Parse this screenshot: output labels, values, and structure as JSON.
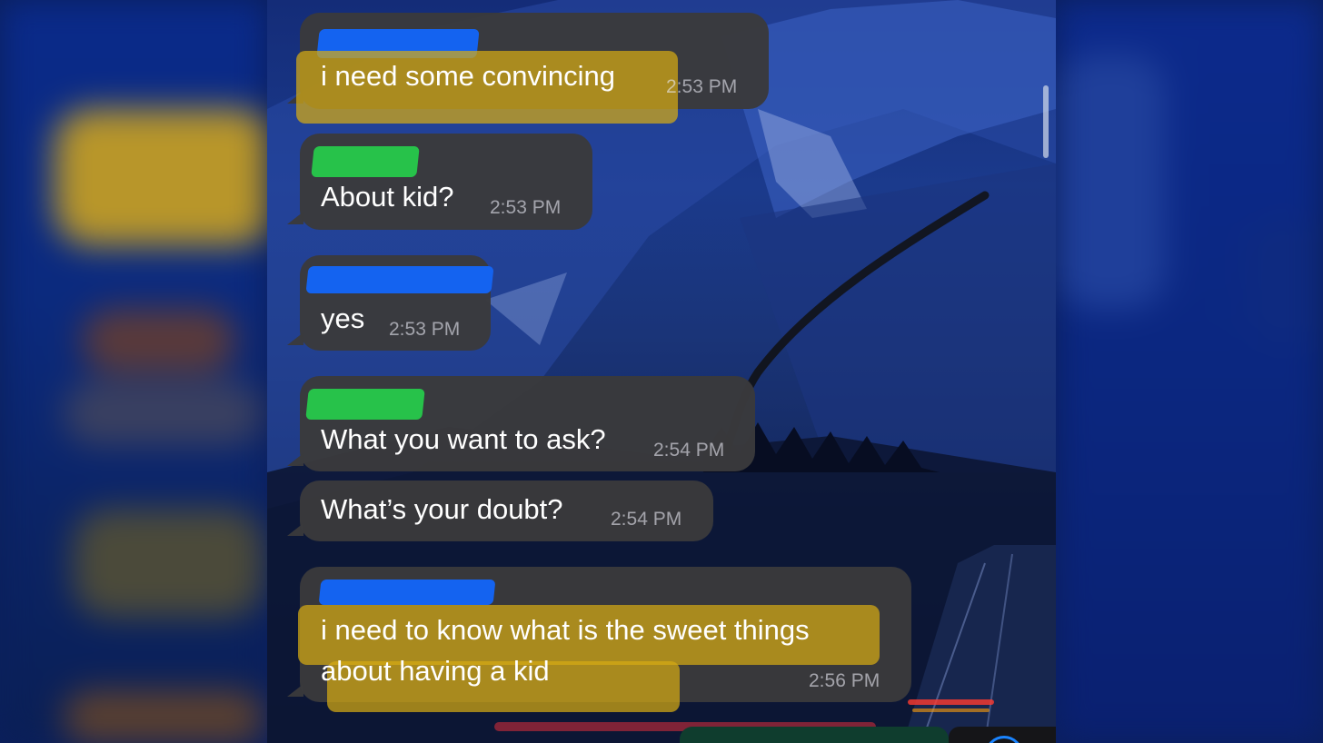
{
  "messages": [
    {
      "text": "i need some convincing",
      "time": "2:53 PM",
      "sender": "redacted-blue",
      "highlighted": true
    },
    {
      "text": "About kid?",
      "time": "2:53 PM",
      "sender": "redacted-green",
      "highlighted": false
    },
    {
      "text": "yes",
      "time": "2:53 PM",
      "sender": "redacted-blue",
      "highlighted": false
    },
    {
      "text": "What you want to ask?",
      "time": "2:54 PM",
      "sender": "redacted-green",
      "highlighted": false
    },
    {
      "text": "What’s your doubt?",
      "time": "2:54 PM",
      "sender": "",
      "highlighted": false
    },
    {
      "line1": "i need to know what is the sweet things",
      "line2": "about having a kid",
      "time": "2:56 PM",
      "sender": "redacted-blue",
      "highlighted": true
    }
  ],
  "colors": {
    "bubble": "#3a3a3c",
    "highlight": "#d6aa14",
    "redact_blue": "#1463f0",
    "redact_green": "#27c24a"
  }
}
